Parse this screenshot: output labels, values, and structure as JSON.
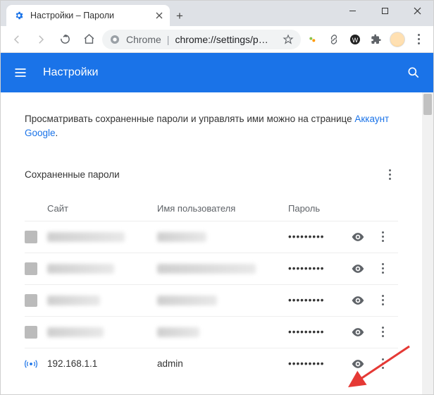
{
  "window": {
    "tab_title": "Настройки – Пароли",
    "url_host": "Chrome",
    "url_path": "chrome://settings/p…"
  },
  "header": {
    "title": "Настройки"
  },
  "hint": {
    "pre": "Просматривать сохраненные пароли и управлять ими можно на странице ",
    "link": "Аккаунт Google",
    "post": "."
  },
  "section": {
    "title": "Сохраненные пароли"
  },
  "columns": {
    "site": "Сайт",
    "user": "Имя пользователя",
    "pass": "Пароль"
  },
  "rows": [
    {
      "site": "████████",
      "user": "████████",
      "mask": "•••••••••",
      "blurred": true,
      "fav": "fav1"
    },
    {
      "site": "████████",
      "user": "████████",
      "mask": "•••••••••",
      "blurred": true,
      "fav": "fav2"
    },
    {
      "site": "████████",
      "user": "████████",
      "mask": "•••••••••",
      "blurred": true,
      "fav": "fav3"
    },
    {
      "site": "████████",
      "user": "████████",
      "mask": "•••••••••",
      "blurred": true,
      "fav": "fav4"
    },
    {
      "site": "192.168.1.1",
      "user": "admin",
      "mask": "•••••••••",
      "blurred": false,
      "fav": "fav5"
    }
  ]
}
